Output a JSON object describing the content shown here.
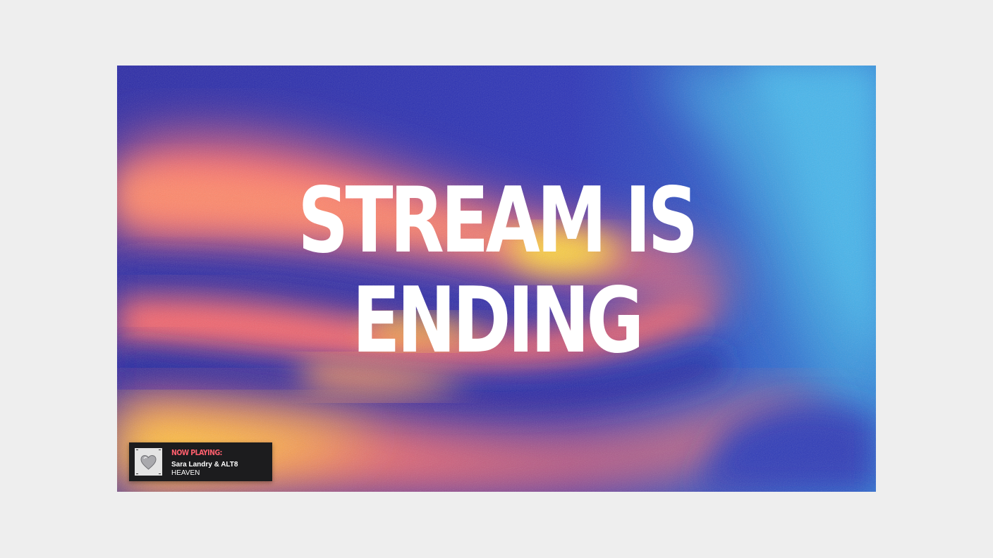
{
  "scene": {
    "headline": {
      "line1": "STREAM IS",
      "line2": "ENDING"
    },
    "colors": {
      "deep_blue": "#2a2fa8",
      "sky_blue": "#3f9fe0",
      "coral": "#ff6f6a",
      "yellow": "#ffd23a",
      "text": "#ffffff"
    }
  },
  "now_playing": {
    "label": "NOW PLAYING:",
    "artist": "Sara Landry & ALT8",
    "title": "HEAVEN",
    "cover_icon": "heart-icon",
    "label_color": "#ff5f6d"
  }
}
